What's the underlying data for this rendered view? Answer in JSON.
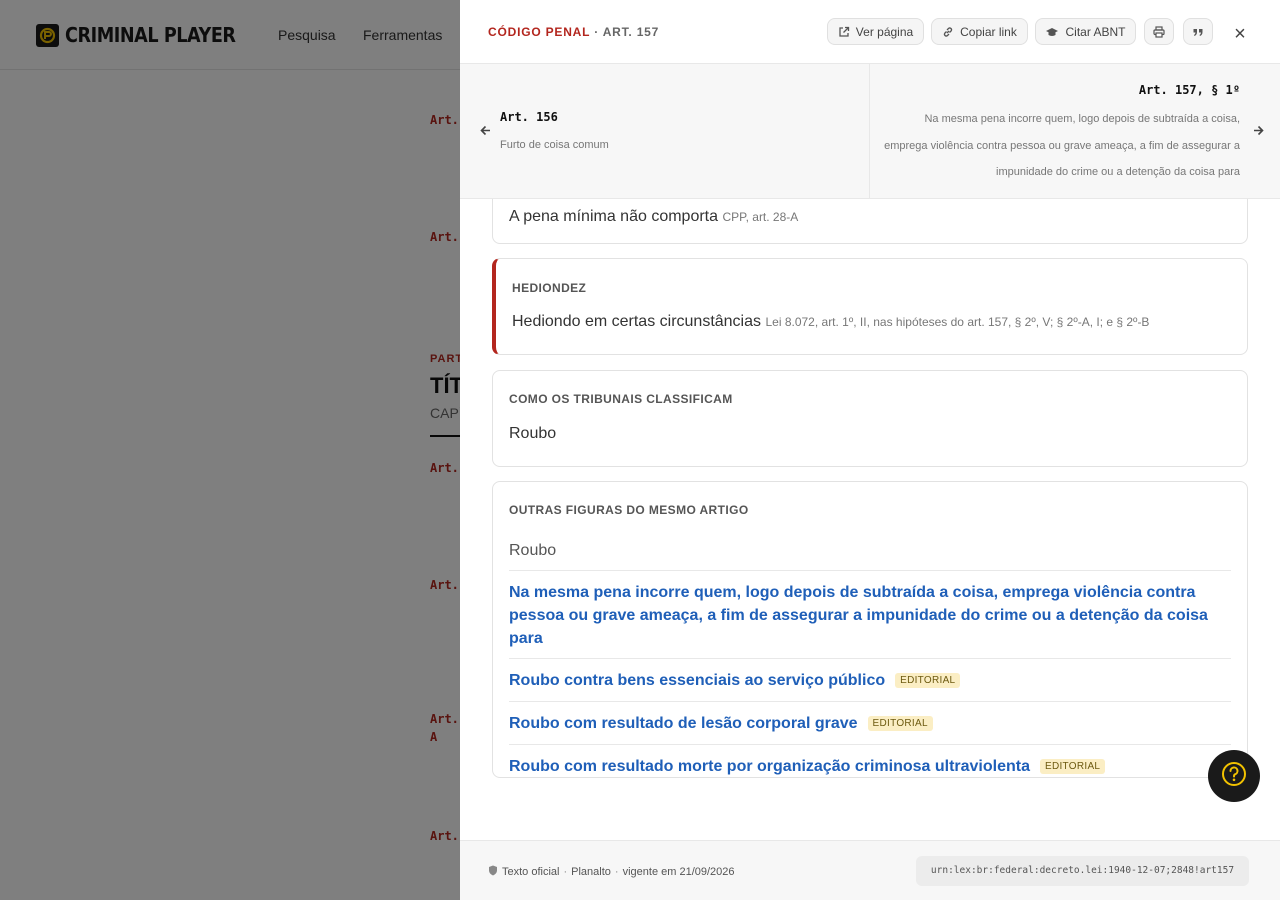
{
  "app": {
    "logo_text": "CRIMINAL PLAYER",
    "nav": [
      "Pesquisa",
      "Ferramentas"
    ]
  },
  "background": {
    "article_labels": [
      "Art.",
      "Art.",
      "Art.",
      "Art.",
      "Art.",
      "Art."
    ],
    "article_a_suffix": "A",
    "part_label": "PART",
    "title_label": "TÍT",
    "chapter_label": "CAPÍ"
  },
  "drawer": {
    "breadcrumb": {
      "code": "CÓDIGO PENAL",
      "separator": "·",
      "article": "ART. 157"
    },
    "buttons": {
      "view_page": "Ver página",
      "copy_link": "Copiar link",
      "cite_abnt": "Citar ABNT",
      "close": "×"
    },
    "prev": {
      "title": "Art. 156",
      "subtitle": "Furto de coisa comum"
    },
    "next": {
      "title": "Art. 157, § 1º",
      "subtitle": "Na mesma pena incorre quem, logo depois de subtraída a coisa, emprega violência contra pessoa ou grave ameaça, a fim de assegurar a impunidade do crime ou a detenção da coisa para"
    },
    "cards": {
      "anpp": {
        "text": "A pena mínima não comporta",
        "source": "CPP, art. 28-A"
      },
      "hediondez": {
        "label": "HEDIONDEZ",
        "text": "Hediondo em certas circunstâncias",
        "source": "Lei 8.072, art. 1º, II, nas hipóteses do art. 157, § 2º, V; § 2º-A, I; e § 2º-B"
      },
      "tribunais": {
        "label": "COMO OS TRIBUNAIS CLASSIFICAM",
        "text": "Roubo"
      },
      "figuras": {
        "label": "OUTRAS FIGURAS DO MESMO ARTIGO",
        "items": [
          {
            "text": "Roubo",
            "badge": ""
          },
          {
            "text": "Na mesma pena incorre quem, logo depois de subtraída a coisa, emprega violência contra pessoa ou grave ameaça, a fim de assegurar a impunidade do crime ou a detenção da coisa para",
            "badge": ""
          },
          {
            "text": "Roubo contra bens essenciais ao serviço público",
            "badge": "EDITORIAL"
          },
          {
            "text": "Roubo com resultado de lesão corporal grave",
            "badge": "EDITORIAL"
          },
          {
            "text": "Roubo com resultado morte por organização criminosa ultraviolenta",
            "badge": "EDITORIAL"
          }
        ]
      }
    },
    "footer": {
      "official": "Texto oficial",
      "source": "Planalto",
      "valid": "vigente em 21/09/2026",
      "urn": "urn:lex:br:federal:decreto.lei:1940-12-07;2848!art157"
    }
  },
  "colors": {
    "accent": "#b3261e",
    "link": "#1f5fb8",
    "badge_bg": "#fbeec4",
    "help_icon": "#f2c200"
  },
  "icons": [
    "external-link-icon",
    "link-icon",
    "graduation-cap-icon",
    "print-icon",
    "quote-icon",
    "close-icon",
    "arrow-left-icon",
    "arrow-right-icon",
    "shield-icon",
    "help-icon"
  ]
}
